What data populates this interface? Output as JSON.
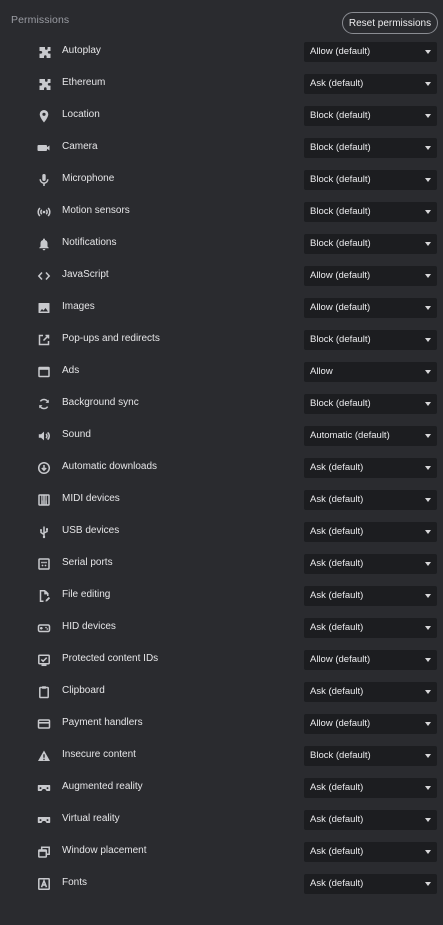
{
  "header": {
    "title": "Permissions",
    "reset_label": "Reset permissions"
  },
  "permissions": [
    {
      "label": "Autoplay",
      "value": "Allow (default)",
      "icon": "puzzle-icon"
    },
    {
      "label": "Ethereum",
      "value": "Ask (default)",
      "icon": "puzzle-icon"
    },
    {
      "label": "Location",
      "value": "Block (default)",
      "icon": "location-pin-icon"
    },
    {
      "label": "Camera",
      "value": "Block (default)",
      "icon": "camera-icon"
    },
    {
      "label": "Microphone",
      "value": "Block (default)",
      "icon": "microphone-icon"
    },
    {
      "label": "Motion sensors",
      "value": "Block (default)",
      "icon": "sensors-icon"
    },
    {
      "label": "Notifications",
      "value": "Block (default)",
      "icon": "bell-icon"
    },
    {
      "label": "JavaScript",
      "value": "Allow (default)",
      "icon": "code-icon"
    },
    {
      "label": "Images",
      "value": "Allow (default)",
      "icon": "image-icon"
    },
    {
      "label": "Pop-ups and redirects",
      "value": "Block (default)",
      "icon": "open-external-icon"
    },
    {
      "label": "Ads",
      "value": "Allow",
      "icon": "window-icon"
    },
    {
      "label": "Background sync",
      "value": "Block (default)",
      "icon": "sync-icon"
    },
    {
      "label": "Sound",
      "value": "Automatic (default)",
      "icon": "speaker-icon"
    },
    {
      "label": "Automatic downloads",
      "value": "Ask (default)",
      "icon": "download-icon"
    },
    {
      "label": "MIDI devices",
      "value": "Ask (default)",
      "icon": "piano-icon"
    },
    {
      "label": "USB devices",
      "value": "Ask (default)",
      "icon": "usb-icon"
    },
    {
      "label": "Serial ports",
      "value": "Ask (default)",
      "icon": "serial-port-icon"
    },
    {
      "label": "File editing",
      "value": "Ask (default)",
      "icon": "file-edit-icon"
    },
    {
      "label": "HID devices",
      "value": "Ask (default)",
      "icon": "gamepad-icon"
    },
    {
      "label": "Protected content IDs",
      "value": "Allow (default)",
      "icon": "verified-check-icon"
    },
    {
      "label": "Clipboard",
      "value": "Ask (default)",
      "icon": "clipboard-icon"
    },
    {
      "label": "Payment handlers",
      "value": "Allow (default)",
      "icon": "credit-card-icon"
    },
    {
      "label": "Insecure content",
      "value": "Block (default)",
      "icon": "warning-icon"
    },
    {
      "label": "Augmented reality",
      "value": "Ask (default)",
      "icon": "vr-headset-icon"
    },
    {
      "label": "Virtual reality",
      "value": "Ask (default)",
      "icon": "vr-headset-icon"
    },
    {
      "label": "Window placement",
      "value": "Ask (default)",
      "icon": "window-placement-icon"
    },
    {
      "label": "Fonts",
      "value": "Ask (default)",
      "icon": "font-icon"
    }
  ],
  "colors": {
    "background": "#2a2b2f",
    "select_background": "#1c1d20",
    "text": "#e6e6e8",
    "muted": "#9a9ca3"
  }
}
